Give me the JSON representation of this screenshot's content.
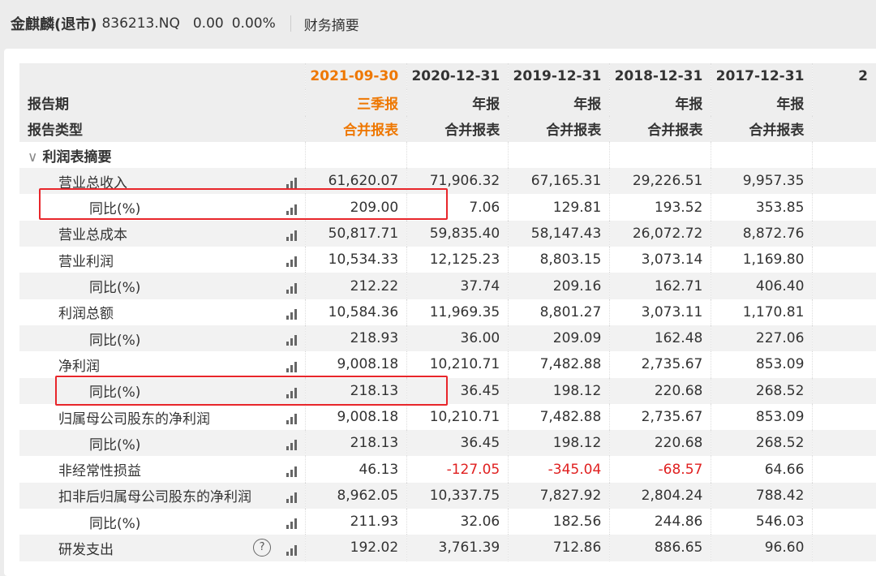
{
  "header": {
    "name": "金麒麟(退市)",
    "code": "836213.NQ",
    "price": "0.00",
    "change_pct": "0.00%",
    "section": "财务摘要"
  },
  "columns": [
    {
      "date": "2021-09-30",
      "period": "三季报",
      "type": "合并报表"
    },
    {
      "date": "2020-12-31",
      "period": "年报",
      "type": "合并报表"
    },
    {
      "date": "2019-12-31",
      "period": "年报",
      "type": "合并报表"
    },
    {
      "date": "2018-12-31",
      "period": "年报",
      "type": "合并报表"
    },
    {
      "date": "2017-12-31",
      "period": "年报",
      "type": "合并报表"
    }
  ],
  "partial_column_date": "2",
  "labels": {
    "period": "报告期",
    "type": "报告类型",
    "section": "利润表摘要"
  },
  "rows": [
    {
      "label": "营业总收入",
      "level": 1,
      "values": [
        "61,620.07",
        "71,906.32",
        "67,165.31",
        "29,226.51",
        "9,957.35"
      ]
    },
    {
      "label": "同比(%)",
      "level": 2,
      "values": [
        "209.00",
        "7.06",
        "129.81",
        "193.52",
        "353.85"
      ]
    },
    {
      "label": "营业总成本",
      "level": 1,
      "values": [
        "50,817.71",
        "59,835.40",
        "58,147.43",
        "26,072.72",
        "8,872.76"
      ]
    },
    {
      "label": "营业利润",
      "level": 1,
      "values": [
        "10,534.33",
        "12,125.23",
        "8,803.15",
        "3,073.14",
        "1,169.80"
      ]
    },
    {
      "label": "同比(%)",
      "level": 2,
      "values": [
        "212.22",
        "37.74",
        "209.16",
        "162.71",
        "406.40"
      ]
    },
    {
      "label": "利润总额",
      "level": 1,
      "values": [
        "10,584.36",
        "11,969.35",
        "8,801.27",
        "3,073.11",
        "1,170.81"
      ]
    },
    {
      "label": "同比(%)",
      "level": 2,
      "values": [
        "218.93",
        "36.00",
        "209.09",
        "162.48",
        "227.06"
      ]
    },
    {
      "label": "净利润",
      "level": 1,
      "values": [
        "9,008.18",
        "10,210.71",
        "7,482.88",
        "2,735.67",
        "853.09"
      ]
    },
    {
      "label": "同比(%)",
      "level": 2,
      "values": [
        "218.13",
        "36.45",
        "198.12",
        "220.68",
        "268.52"
      ]
    },
    {
      "label": "归属母公司股东的净利润",
      "level": 1,
      "values": [
        "9,008.18",
        "10,210.71",
        "7,482.88",
        "2,735.67",
        "853.09"
      ]
    },
    {
      "label": "同比(%)",
      "level": 2,
      "values": [
        "218.13",
        "36.45",
        "198.12",
        "220.68",
        "268.52"
      ]
    },
    {
      "label": "非经常性损益",
      "level": 1,
      "values": [
        "46.13",
        "-127.05",
        "-345.04",
        "-68.57",
        "64.66"
      ]
    },
    {
      "label": "扣非后归属母公司股东的净利润",
      "level": 1,
      "values": [
        "8,962.05",
        "10,337.75",
        "7,827.92",
        "2,804.24",
        "788.42"
      ]
    },
    {
      "label": "同比(%)",
      "level": 2,
      "values": [
        "211.93",
        "32.06",
        "182.56",
        "244.86",
        "546.03"
      ]
    },
    {
      "label": "研发支出",
      "level": 1,
      "help": "?",
      "values": [
        "192.02",
        "3,761.39",
        "712.86",
        "886.65",
        "96.60"
      ]
    }
  ],
  "colors": {
    "accent": "#ee7700",
    "negative": "#e02020",
    "highlight_box": "#e8262b"
  }
}
